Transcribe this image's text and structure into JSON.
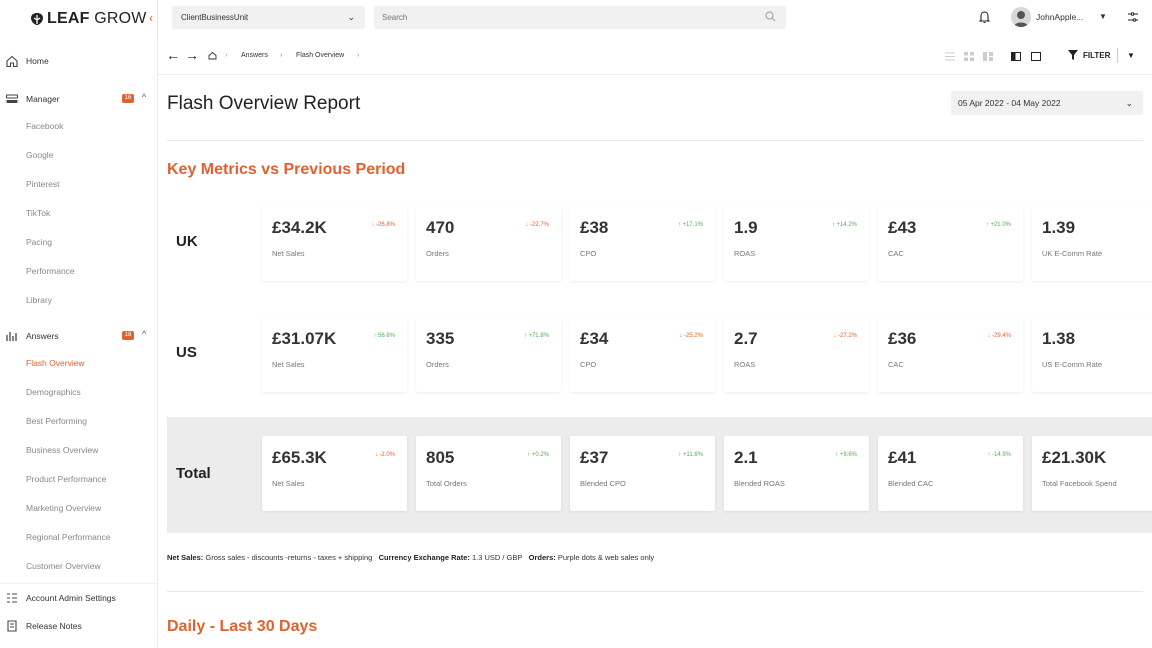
{
  "app": {
    "logo_bold": "LEAF",
    "logo_light": " GROW"
  },
  "sidebar": {
    "home": "Home",
    "manager": {
      "label": "Manager",
      "badge": "16",
      "items": [
        "Facebook",
        "Google",
        "Pinterest",
        "TikTok",
        "Pacing",
        "Performance",
        "Library"
      ]
    },
    "answers": {
      "label": "Answers",
      "badge": "18",
      "items": [
        "Flash Overview",
        "Demographics",
        "Best Performing",
        "Business Overview",
        "Product Performance",
        "Marketing Overview",
        "Regional Performance",
        "Customer Overview"
      ]
    },
    "account_admin": "Account Admin Settings",
    "release_notes": "Release Notes"
  },
  "topbar": {
    "business_unit": "ClientBusinessUnit",
    "search_placeholder": "Search",
    "username": "JohnApple..."
  },
  "breadcrumb": {
    "items": [
      "Answers",
      "Flash Overview"
    ]
  },
  "toolbar": {
    "filter_label": "FILTER"
  },
  "page": {
    "title": "Flash Overview Report",
    "date_range": "05 Apr 2022 - 04 May 2022",
    "key_metrics_title": "Key Metrics vs Previous Period",
    "daily_title": "Daily - Last 30 Days"
  },
  "regions": [
    {
      "label": "UK",
      "cards": [
        {
          "value": "£34.2K",
          "change": "-26.8%",
          "dir": "down",
          "label": "Net Sales"
        },
        {
          "value": "470",
          "change": "-22.7%",
          "dir": "down",
          "label": "Orders"
        },
        {
          "value": "£38",
          "change": "+17.1%",
          "dir": "up",
          "label": "CPO"
        },
        {
          "value": "1.9",
          "change": "+14.2%",
          "dir": "up",
          "label": "ROAS"
        },
        {
          "value": "£43",
          "change": "+21.0%",
          "dir": "up",
          "label": "CAC"
        },
        {
          "value": "1.39",
          "change": "",
          "dir": "down",
          "label": "UK E-Comm Rate"
        }
      ]
    },
    {
      "label": "US",
      "cards": [
        {
          "value": "£31.07K",
          "change": "56.6%",
          "dir": "up",
          "label": "Net Sales"
        },
        {
          "value": "335",
          "change": "+71.8%",
          "dir": "up",
          "label": "Orders"
        },
        {
          "value": "£34",
          "change": "-25.2%",
          "dir": "down",
          "label": "CPO"
        },
        {
          "value": "2.7",
          "change": "-27.2%",
          "dir": "down",
          "label": "ROAS"
        },
        {
          "value": "£36",
          "change": "-29.4%",
          "dir": "down",
          "label": "CAC"
        },
        {
          "value": "1.38",
          "change": "",
          "dir": "up",
          "label": "US E-Comm Rate"
        }
      ]
    },
    {
      "label": "Total",
      "cards": [
        {
          "value": "£65.3K",
          "change": "-2.0%",
          "dir": "down",
          "label": "Net Sales"
        },
        {
          "value": "805",
          "change": "+0.2%",
          "dir": "up",
          "label": "Total Orders"
        },
        {
          "value": "£37",
          "change": "+11.6%",
          "dir": "up",
          "label": "Blended CPO"
        },
        {
          "value": "2.1",
          "change": "+9.6%",
          "dir": "up",
          "label": "Blended ROAS"
        },
        {
          "value": "£41",
          "change": "-14.9%",
          "dir": "up",
          "label": "Blended CAC"
        },
        {
          "value": "£21.30K",
          "change": "",
          "dir": "flat",
          "label": "Total Facebook Spend"
        }
      ]
    }
  ],
  "footnote": {
    "net_sales_label": "Net Sales:",
    "net_sales_text": " Gross sales - discounts -returns - taxes + shipping",
    "fx_label": "Currency Exchange Rate:",
    "fx_text": " 1.3 USD / GBP",
    "orders_label": "Orders:",
    "orders_text": " Purple dots & web sales only"
  },
  "colors": {
    "accent": "#e0622e",
    "positive": "#4caf50",
    "negative": "#e0622e"
  }
}
